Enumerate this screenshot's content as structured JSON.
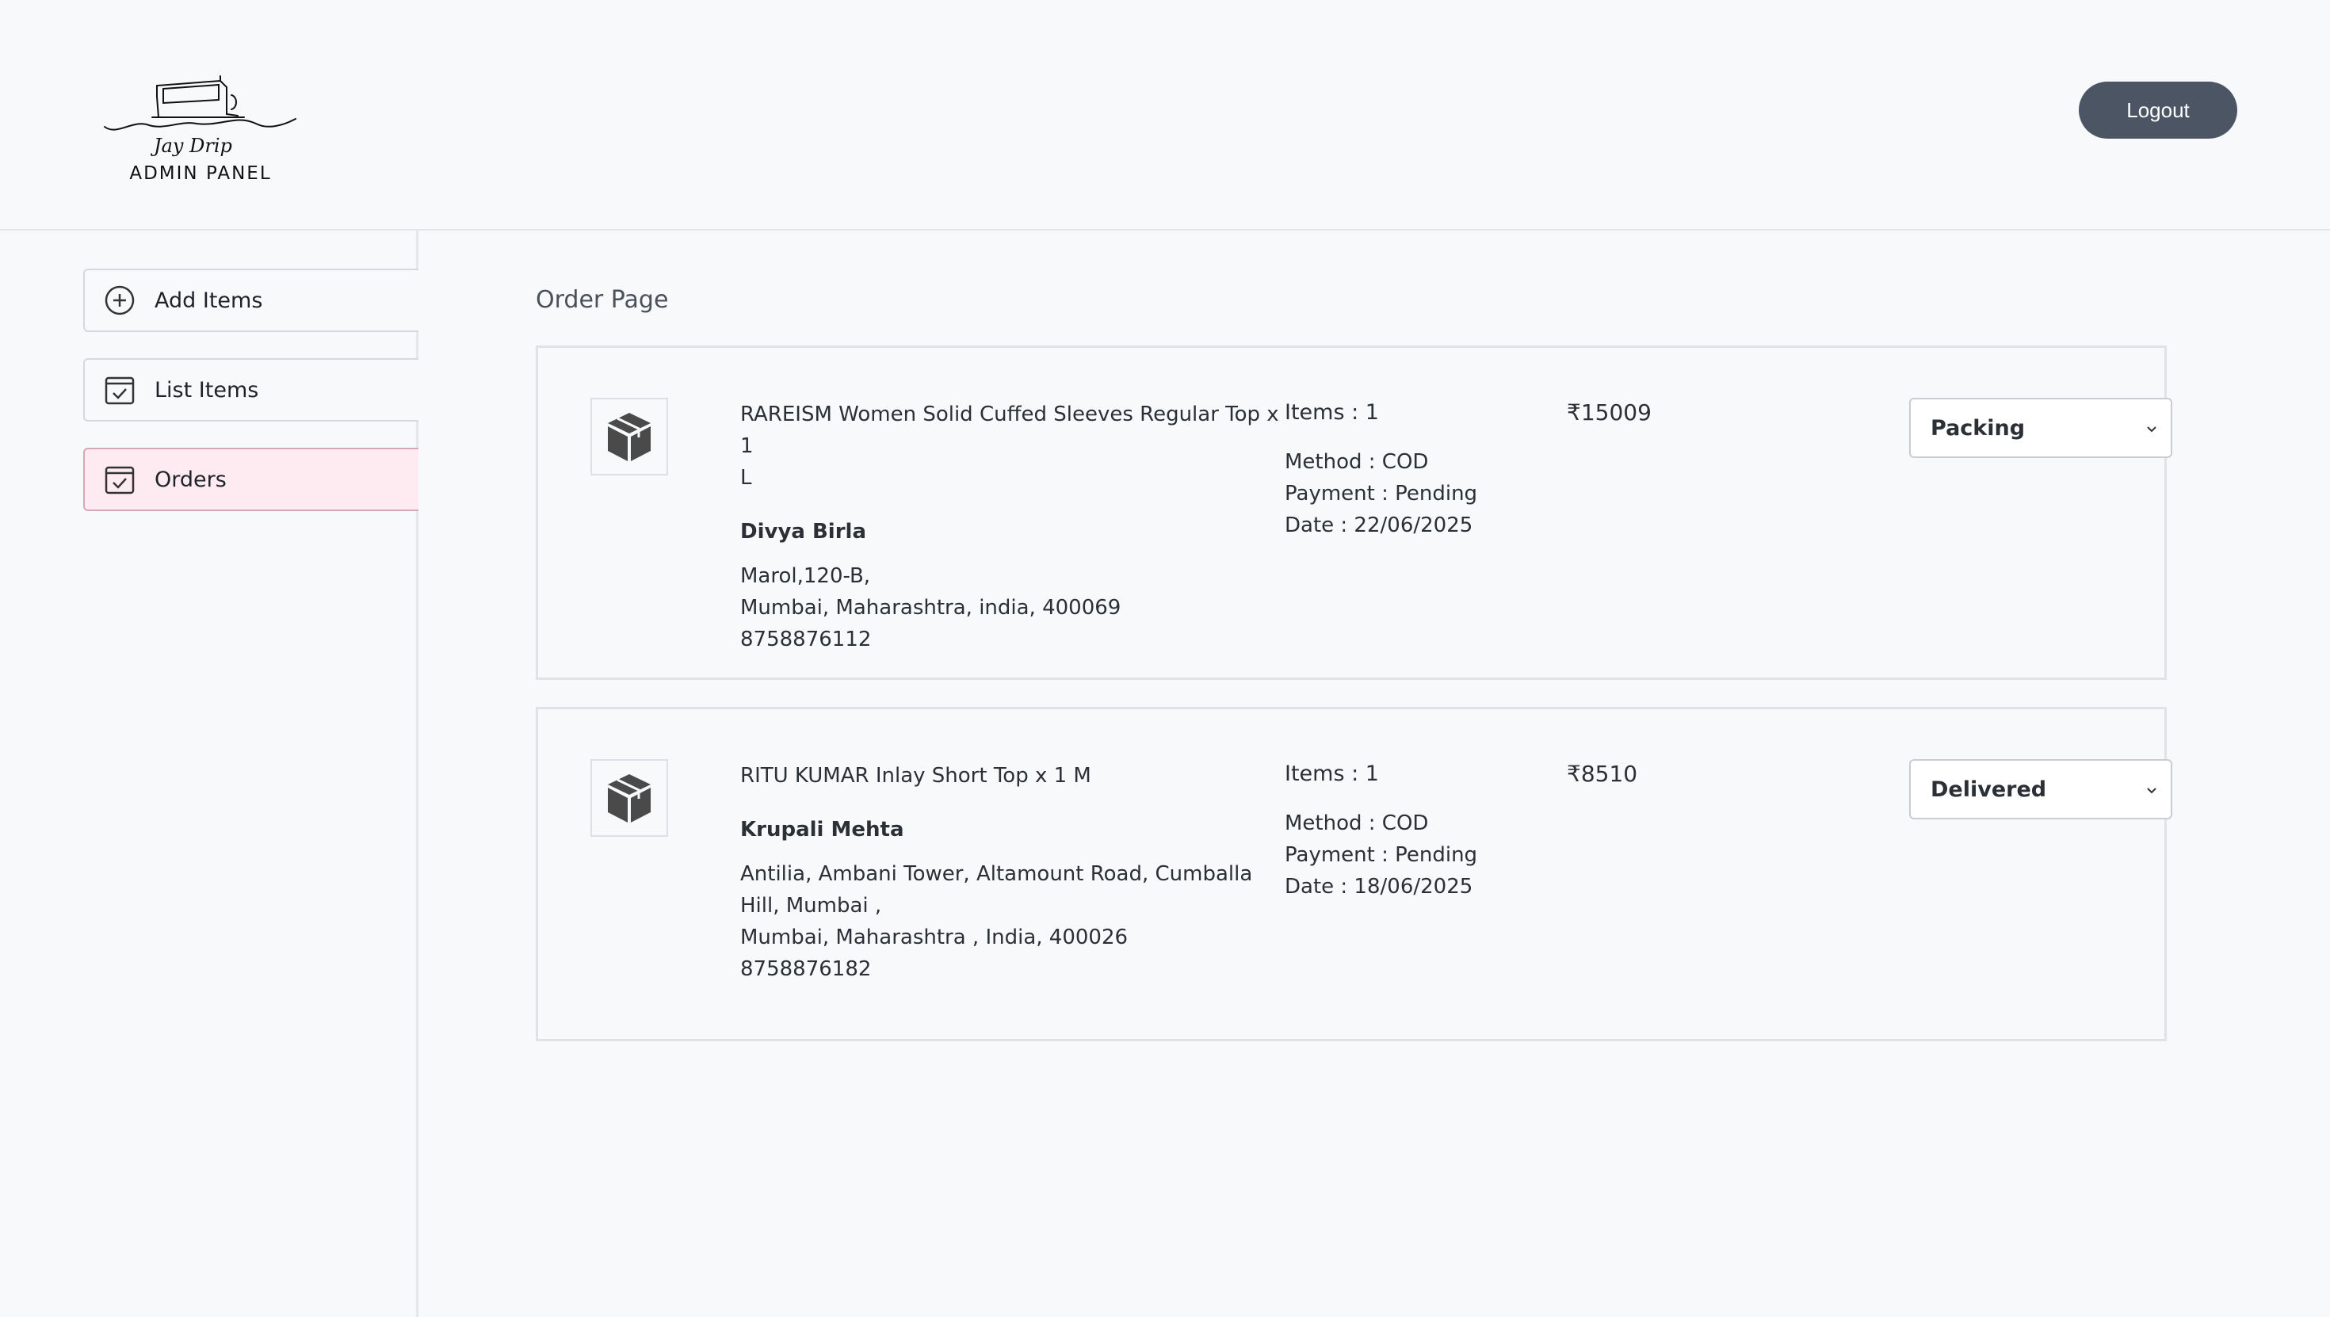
{
  "header": {
    "logo_script": "Jay Drip",
    "logo_subtitle": "ADMIN PANEL",
    "logout_label": "Logout"
  },
  "sidebar": {
    "items": [
      {
        "label": "Add Items",
        "icon": "plus-circle-icon"
      },
      {
        "label": "List Items",
        "icon": "checklist-icon"
      },
      {
        "label": "Orders",
        "icon": "checklist-icon",
        "active": true
      }
    ]
  },
  "main": {
    "title": "Order Page",
    "orders": [
      {
        "item_line1": "RAREISM Women Solid Cuffed Sleeves Regular Top x 1",
        "item_line2": "L",
        "customer": "Divya Birla",
        "addr1": "Marol,120-B,",
        "addr2": "Mumbai, Maharashtra, india, 400069",
        "phone": "8758876112",
        "items_count": "Items : 1",
        "method": "Method : COD",
        "payment": "Payment : Pending",
        "date": "Date : 22/06/2025",
        "amount": "₹15009",
        "status": "Packing"
      },
      {
        "item_line1": "RITU KUMAR Inlay Short Top x 1 M",
        "customer": "Krupali Mehta",
        "addr1": "Antilia, Ambani Tower, Altamount Road, Cumballa",
        "addr2": "Hill, Mumbai ,",
        "addr3": "Mumbai, Maharashtra , India, 400026",
        "phone": "8758876182",
        "items_count": "Items : 1",
        "method": "Method : COD",
        "payment": "Payment : Pending",
        "date": "Date : 18/06/2025",
        "amount": "₹8510",
        "status": "Delivered"
      }
    ]
  },
  "colors": {
    "active_bg": "#fdebf1",
    "active_border": "#d9a5b8",
    "logout_bg": "#4b5563"
  }
}
